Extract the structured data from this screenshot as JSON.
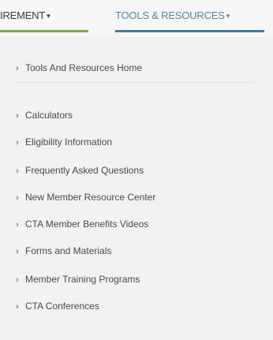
{
  "topnav": {
    "retirement_label": "IREMENT",
    "tools_label": "TOOLS & RESOURCES",
    "caret": "▾"
  },
  "menu": {
    "chevron": "›",
    "items": [
      {
        "label": "Tools And Resources Home"
      },
      {
        "label": "Calculators"
      },
      {
        "label": "Eligibility Information"
      },
      {
        "label": "Frequently Asked Questions"
      },
      {
        "label": "New Member Resource Center"
      },
      {
        "label": "CTA Member Benefits Videos"
      },
      {
        "label": "Forms and Materials"
      },
      {
        "label": "Member Training Programs"
      },
      {
        "label": "CTA Conferences"
      }
    ]
  },
  "colors": {
    "retirement_underline": "#77a948",
    "tools_underline": "#3b7fa9",
    "tools_text": "#4b86a8"
  }
}
